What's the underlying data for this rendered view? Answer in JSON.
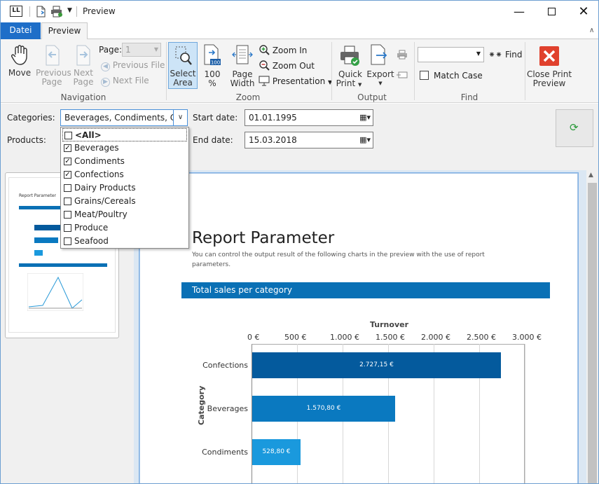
{
  "window": {
    "app_icon": "LL",
    "title": "Preview",
    "controls": [
      "minimize-icon",
      "maximize-icon",
      "close-icon"
    ]
  },
  "tabs": [
    {
      "label": "Datei",
      "active": false
    },
    {
      "label": "Preview",
      "active": true
    }
  ],
  "ribbon": {
    "navigation": {
      "group_label": "Navigation",
      "move": "Move",
      "previous_page": [
        "Previous",
        "Page"
      ],
      "next_page": [
        "Next",
        "Page"
      ],
      "page_label": "Page:",
      "page_value": "1",
      "previous_file": "Previous File",
      "next_file": "Next File"
    },
    "zoom": {
      "group_label": "Zoom",
      "select_area": [
        "Select",
        "Area"
      ],
      "zoom_100": [
        "100",
        "%"
      ],
      "page_width": [
        "Page",
        "Width"
      ],
      "zoom_in": "Zoom In",
      "zoom_out": "Zoom Out",
      "presentation": "Presentation"
    },
    "output": {
      "group_label": "Output",
      "quick_print": [
        "Quick",
        "Print"
      ],
      "export": "Export"
    },
    "find": {
      "group_label": "Find",
      "find": "Find",
      "match_case": "Match Case"
    },
    "close": [
      "Close Print",
      "Preview"
    ]
  },
  "params": {
    "categories_label": "Categories:",
    "categories_value": "Beverages, Condiments, Conf",
    "products_label": "Products:",
    "start_label": "Start date:",
    "start_value": "01.01.1995",
    "end_label": "End date:",
    "end_value": "15.03.2018"
  },
  "dropdown": {
    "items": [
      {
        "label": "<All>",
        "checked": false
      },
      {
        "label": "Beverages",
        "checked": true
      },
      {
        "label": "Condiments",
        "checked": true
      },
      {
        "label": "Confections",
        "checked": true
      },
      {
        "label": "Dairy Products",
        "checked": false
      },
      {
        "label": "Grains/Cereals",
        "checked": false
      },
      {
        "label": "Meat/Poultry",
        "checked": false
      },
      {
        "label": "Produce",
        "checked": false
      },
      {
        "label": "Seafood",
        "checked": false
      }
    ]
  },
  "report": {
    "title": "Report Parameter",
    "description": [
      "You can control the output result of the following charts in the preview with the use of report",
      "parameters."
    ],
    "section_title": "Total sales per category",
    "accent_color": "#0a70b5"
  },
  "chart_data": {
    "type": "bar",
    "orientation": "horizontal",
    "xlabel": "Turnover",
    "ylabel": "Category",
    "x_ticks": [
      "0 €",
      "500 €",
      "1.000 €",
      "1.500 €",
      "2.000 €",
      "2.500 €",
      "3.000 €"
    ],
    "xlim": [
      0,
      3000
    ],
    "categories": [
      "Confections",
      "Beverages",
      "Condiments"
    ],
    "values": [
      2727.15,
      1570.8,
      528.8
    ],
    "value_labels": [
      "2.727,15 €",
      "1.570,80 €",
      "528,80 €"
    ],
    "colors": [
      "#045a9d",
      "#0a79c0",
      "#1a99dd"
    ]
  }
}
